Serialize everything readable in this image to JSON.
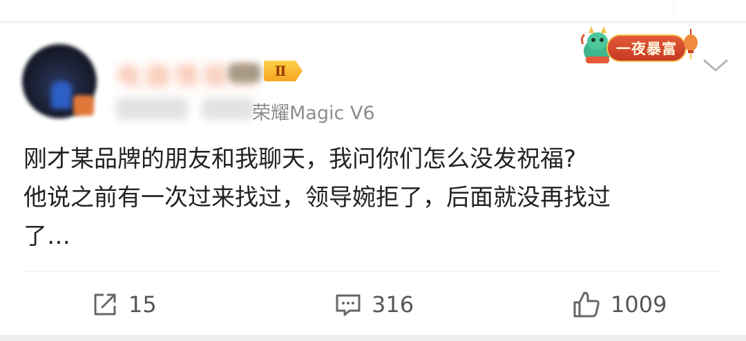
{
  "post": {
    "author": {
      "name": "电器情报员",
      "level_badge": "Ⅱ"
    },
    "source": "荣耀Magic V6",
    "festival_badge": "一夜暴富",
    "content_lines": [
      "刚才某品牌的朋友和我聊天，我问你们怎么没发祝福?",
      "他说之前有一次过来找过，领导婉拒了，后面就没再找过",
      "了…"
    ]
  },
  "actions": {
    "repost_count": "15",
    "comment_count": "316",
    "like_count": "1009"
  },
  "icons": {
    "repost": "repost-icon",
    "comment": "comment-icon",
    "like": "thumbs-up-icon",
    "menu": "chevron-down-icon"
  },
  "colors": {
    "accent": "#f17a4b",
    "badge_gold": "#f5a623",
    "festival_red": "#c53a22",
    "text": "#222222",
    "meta": "#8c8c8c"
  }
}
